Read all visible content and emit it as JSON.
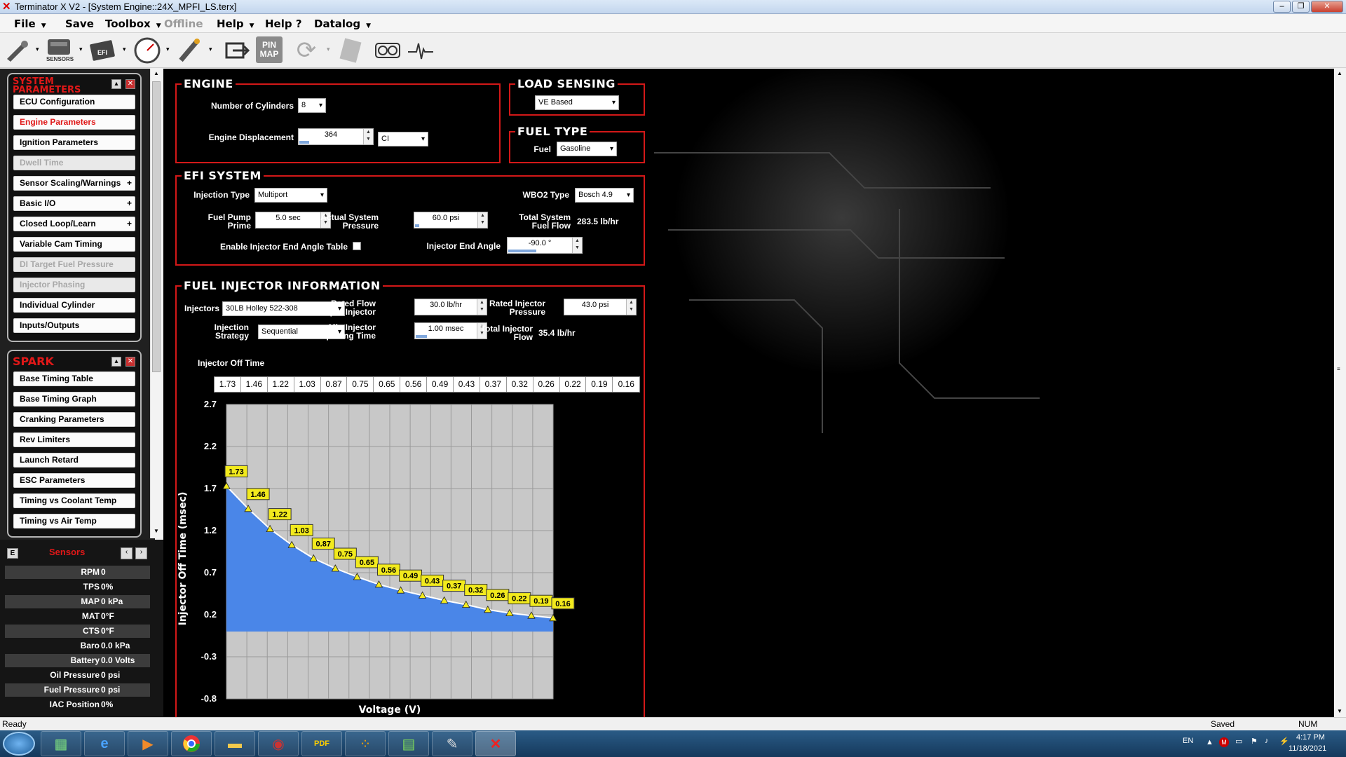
{
  "window": {
    "title": "Terminator X V2 - [System Engine::24X_MPFI_LS.terx]",
    "icon": "x-logo-icon"
  },
  "menu": [
    {
      "label": "File",
      "dropdown": true
    },
    {
      "label": "Save",
      "dropdown": false
    },
    {
      "label": "Toolbox",
      "dropdown": true
    },
    {
      "label": "Offline",
      "dropdown": false,
      "disabled": true
    },
    {
      "label": "Help",
      "dropdown": true
    },
    {
      "label": "Help ?",
      "dropdown": false
    },
    {
      "label": "Datalog",
      "dropdown": true
    }
  ],
  "toolbar": {
    "items": [
      "injector-icon",
      "sensors-icon",
      "efi-icon",
      "gauge-icon",
      "spark-plug-icon",
      "transfer-icon",
      "pin-map-icon",
      "refresh-icon",
      "notes-icon",
      "dashboard-icon",
      "waveform-icon"
    ],
    "sensors_caption": "SENSORS",
    "efi_caption": "EFI",
    "pin_map_caption": "PIN MAP"
  },
  "system_parameters": {
    "title_line1": "SYSTEM",
    "title_line2": "PARAMETERS",
    "items": [
      {
        "label": "ECU Configuration",
        "state": "normal",
        "plus": false
      },
      {
        "label": "Engine Parameters",
        "state": "active",
        "plus": false
      },
      {
        "label": "Ignition Parameters",
        "state": "normal",
        "plus": false
      },
      {
        "label": "Dwell Time",
        "state": "disabled",
        "plus": false
      },
      {
        "label": "Sensor Scaling/Warnings",
        "state": "normal",
        "plus": true
      },
      {
        "label": "Basic I/O",
        "state": "normal",
        "plus": true
      },
      {
        "label": "Closed Loop/Learn",
        "state": "normal",
        "plus": true
      },
      {
        "label": "Variable Cam Timing",
        "state": "normal",
        "plus": false
      },
      {
        "label": "DI Target Fuel Pressure",
        "state": "disabled",
        "plus": false
      },
      {
        "label": "Injector Phasing",
        "state": "disabled",
        "plus": false
      },
      {
        "label": "Individual Cylinder",
        "state": "normal",
        "plus": false
      },
      {
        "label": "Inputs/Outputs",
        "state": "normal",
        "plus": false
      }
    ]
  },
  "spark": {
    "title": "SPARK",
    "items": [
      "Base Timing Table",
      "Base Timing Graph",
      "Cranking Parameters",
      "Rev Limiters",
      "Launch Retard",
      "ESC Parameters",
      "Timing vs Coolant Temp",
      "Timing vs Air Temp"
    ]
  },
  "sensors": {
    "title": "Sensors",
    "e_label": "E",
    "rows": [
      {
        "label": "RPM",
        "value": "0"
      },
      {
        "label": "TPS",
        "value": "0%"
      },
      {
        "label": "MAP",
        "value": "0 kPa"
      },
      {
        "label": "MAT",
        "value": "0°F"
      },
      {
        "label": "CTS",
        "value": "0°F"
      },
      {
        "label": "Baro",
        "value": "0.0 kPa"
      },
      {
        "label": "Battery",
        "value": "0.0 Volts"
      },
      {
        "label": "Oil Pressure",
        "value": "0 psi"
      },
      {
        "label": "Fuel Pressure",
        "value": "0 psi"
      },
      {
        "label": "IAC Position",
        "value": "0%"
      }
    ]
  },
  "engine": {
    "title": "ENGINE",
    "cylinders_label": "Number of Cylinders",
    "cylinders_value": "8",
    "displacement_label": "Engine Displacement",
    "displacement_value": "364",
    "displacement_unit": "CI"
  },
  "load_sensing": {
    "title": "LOAD SENSING",
    "value": "VE Based"
  },
  "fuel_type": {
    "title": "FUEL TYPE",
    "fuel_label": "Fuel",
    "fuel_value": "Gasoline"
  },
  "efi_system": {
    "title": "EFI SYSTEM",
    "injection_type_label": "Injection Type",
    "injection_type_value": "Multiport",
    "wbo2_label": "WBO2 Type",
    "wbo2_value": "Bosch 4.9",
    "fuel_pump_prime_label1": "Fuel Pump",
    "fuel_pump_prime_label2": "Prime",
    "fuel_pump_prime_value": "5.0 sec",
    "actual_pressure_label1": "Actual System",
    "actual_pressure_label2": "Pressure",
    "actual_pressure_value": "60.0 psi",
    "total_flow_label1": "Total System",
    "total_flow_label2": "Fuel Flow",
    "total_flow_value": "283.5 lb/hr",
    "enable_end_angle_label": "Enable Injector End Angle Table",
    "end_angle_label": "Injector End Angle",
    "end_angle_value": "-90.0 °"
  },
  "injector_info": {
    "title": "FUEL INJECTOR INFORMATION",
    "injectors_label": "Injectors",
    "injectors_value": "30LB Holley 522-308",
    "rated_flow_label1": "Rated Flow",
    "rated_flow_label2": "per Injector",
    "rated_flow_value": "30.0 lb/hr",
    "rated_pressure_label1": "Rated Injector",
    "rated_pressure_label2": "Pressure",
    "rated_pressure_value": "43.0 psi",
    "strategy_label1": "Injection",
    "strategy_label2": "Strategy",
    "strategy_value": "Sequential",
    "min_open_label1": "Min Injector",
    "min_open_label2": "Opening Time",
    "min_open_value": "1.00 msec",
    "total_flow_label1": "Total Injector",
    "total_flow_label2": "Flow",
    "total_flow_value": "35.4 lb/hr",
    "off_time_label": "Injector Off Time"
  },
  "chart_data": {
    "type": "area",
    "title": "",
    "xlabel": "Voltage (V)",
    "ylabel": "Injector Off Time (msec)",
    "ylim": [
      -0.8,
      2.7
    ],
    "yticks": [
      "2.7",
      "2.2",
      "1.7",
      "1.2",
      "0.7",
      "0.2",
      "-0.3",
      "-0.8"
    ],
    "grid": true,
    "values": [
      1.73,
      1.46,
      1.22,
      1.03,
      0.87,
      0.75,
      0.65,
      0.56,
      0.49,
      0.43,
      0.37,
      0.32,
      0.26,
      0.22,
      0.19,
      0.16
    ],
    "labels": [
      "1.73",
      "1.46",
      "1.22",
      "1.03",
      "0.87",
      "0.75",
      "0.65",
      "0.56",
      "0.49",
      "0.43",
      "0.37",
      "0.32",
      "0.26",
      "0.22",
      "0.19",
      "0.16"
    ],
    "colors": {
      "fill": "#4a86e8",
      "plot_bg": "#c8c8c8",
      "label_bg": "#f2ea1d"
    }
  },
  "status": {
    "left": "Ready",
    "saved": "Saved",
    "num": "NUM"
  },
  "taskbar": {
    "apps": [
      "start-orb-icon",
      "app-grid-icon",
      "ie-icon",
      "media-icon",
      "chrome-icon",
      "folder-icon",
      "disc-icon",
      "pdf-icon",
      "dots-app-icon",
      "chart-app-icon",
      "paint-icon",
      "terminator-x-icon"
    ],
    "lang": "EN",
    "time": "4:17 PM",
    "date": "11/18/2021"
  }
}
